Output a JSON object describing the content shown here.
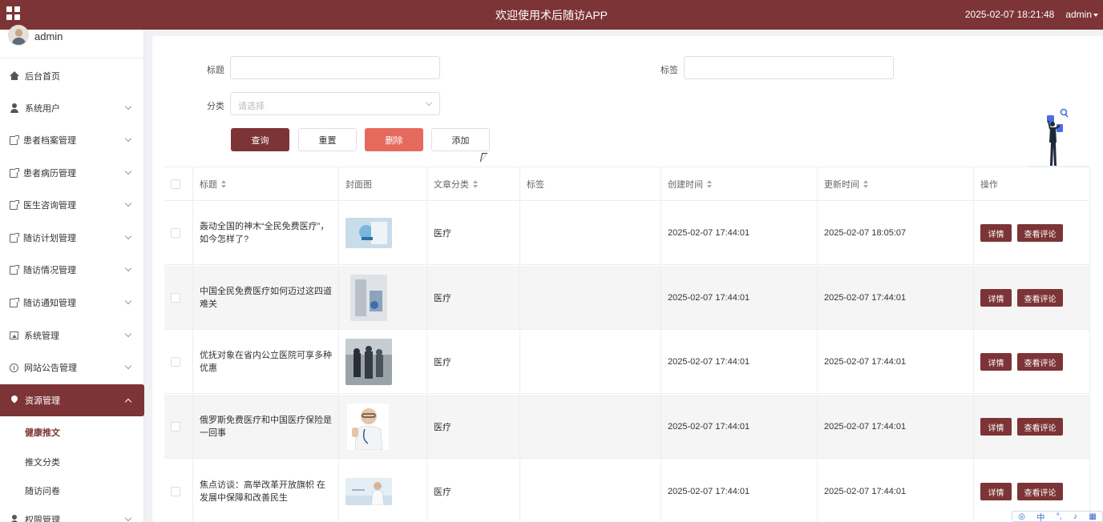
{
  "header": {
    "title": "欢迎使用术后随访APP",
    "datetime": "2025-02-07 18:21:48",
    "user": "admin"
  },
  "sidebar": {
    "username": "admin",
    "items": [
      {
        "label": "后台首页",
        "icon": "home-icon"
      },
      {
        "label": "系统用户",
        "icon": "user-icon"
      },
      {
        "label": "患者档案管理",
        "icon": "document-icon"
      },
      {
        "label": "患者病历管理",
        "icon": "document-icon"
      },
      {
        "label": "医生咨询管理",
        "icon": "document-icon"
      },
      {
        "label": "随访计划管理",
        "icon": "document-icon"
      },
      {
        "label": "随访情况管理",
        "icon": "document-icon"
      },
      {
        "label": "随访通知管理",
        "icon": "document-icon"
      },
      {
        "label": "系统管理",
        "icon": "image-icon"
      },
      {
        "label": "网站公告管理",
        "icon": "info-icon"
      },
      {
        "label": "资源管理",
        "icon": "location-pin-icon"
      },
      {
        "label": "权限管理",
        "icon": "user-icon"
      }
    ],
    "subitems": [
      "健康推文",
      "推文分类",
      "随访问卷"
    ]
  },
  "filters": {
    "title_label": "标题",
    "tag_label": "标签",
    "category_label": "分类",
    "category_placeholder": "请选择",
    "title_value": "",
    "tag_value": ""
  },
  "buttons": {
    "search": "查询",
    "reset": "重置",
    "delete": "删除",
    "add": "添加"
  },
  "table": {
    "headers": {
      "title": "标题",
      "cover": "封面图",
      "category": "文章分类",
      "tags": "标签",
      "created": "创建时间",
      "updated": "更新时间",
      "actions": "操作"
    },
    "action_labels": {
      "detail": "详情",
      "comments": "查看评论"
    },
    "rows": [
      {
        "title": "轰动全国的神木“全民免费医疗”，如今怎样了?",
        "category": "医疗",
        "tags": "",
        "created": "2025-02-07 17:44:01",
        "updated": "2025-02-07 18:05:07"
      },
      {
        "title": "中国全民免费医疗如何迈过这四道难关",
        "category": "医疗",
        "tags": "",
        "created": "2025-02-07 17:44:01",
        "updated": "2025-02-07 17:44:01"
      },
      {
        "title": "优抚对象在省内公立医院可享多种优惠",
        "category": "医疗",
        "tags": "",
        "created": "2025-02-07 17:44:01",
        "updated": "2025-02-07 17:44:01"
      },
      {
        "title": "俄罗斯免费医疗和中国医疗保险是一回事",
        "category": "医疗",
        "tags": "",
        "created": "2025-02-07 17:44:01",
        "updated": "2025-02-07 17:44:01"
      },
      {
        "title": "焦点访谈：高举改革开放旗帜 在发展中保障和改善民生",
        "category": "医疗",
        "tags": "",
        "created": "2025-02-07 17:44:01",
        "updated": "2025-02-07 17:44:01"
      }
    ]
  },
  "ime": {
    "lang": "中"
  },
  "colors": {
    "brand": "#7d3436",
    "danger": "#e56a5d"
  }
}
